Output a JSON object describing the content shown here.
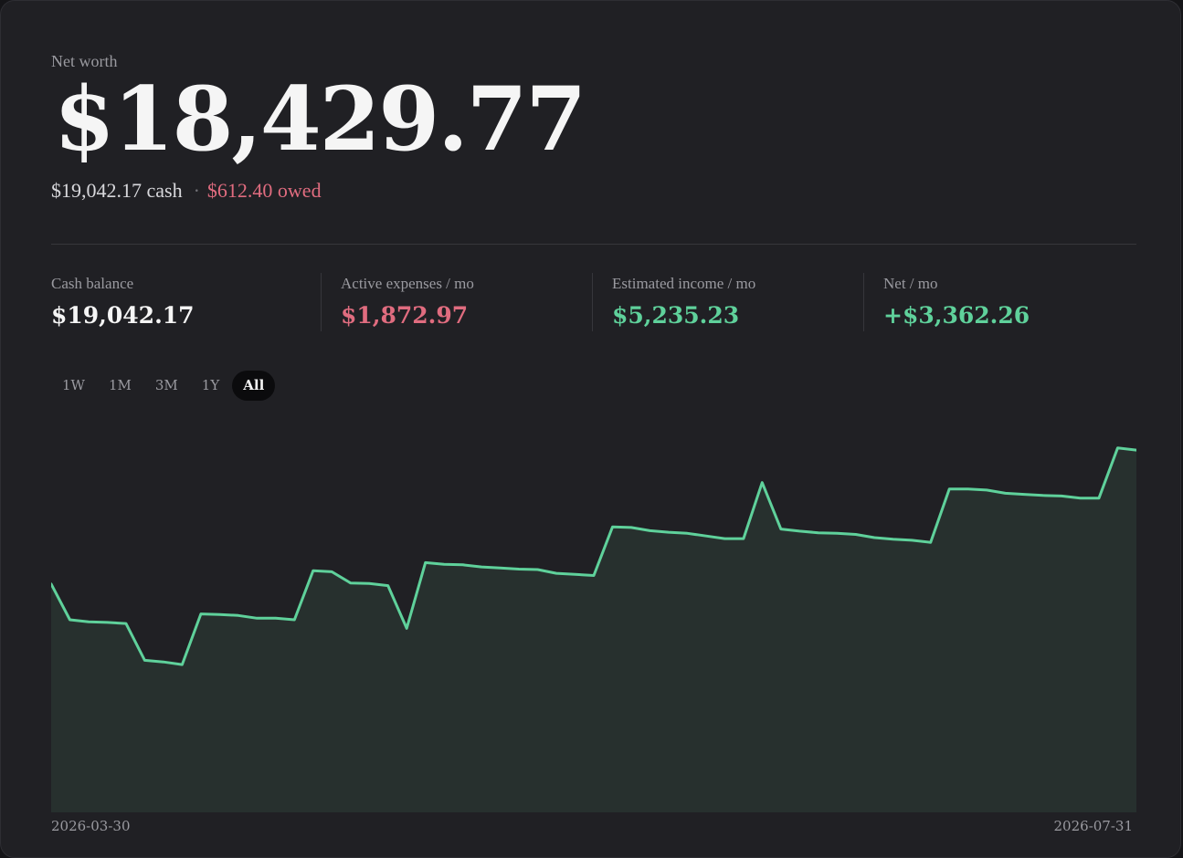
{
  "net_worth": {
    "label": "Net worth",
    "value": "$18,429.77",
    "cash_text": "$19,042.17 cash",
    "separator": "·",
    "owed_text": "$612.40 owed"
  },
  "stats": [
    {
      "label": "Cash balance",
      "value": "$19,042.17"
    },
    {
      "label": "Active expenses / mo",
      "value": "$1,872.97"
    },
    {
      "label": "Estimated income / mo",
      "value": "$5,235.23"
    },
    {
      "label": "Net / mo",
      "value": "+$3,362.26"
    }
  ],
  "range": {
    "options": [
      "1W",
      "1M",
      "3M",
      "1Y",
      "All"
    ],
    "selected": "All"
  },
  "chart_data": {
    "type": "area",
    "x_start_label": "2026-03-30",
    "x_end_label": "2026-07-31",
    "series": [
      {
        "values": [
          4210,
          3540,
          3500,
          3490,
          3470,
          2780,
          2750,
          2700,
          3650,
          3640,
          3620,
          3570,
          3570,
          3540,
          4460,
          4440,
          4230,
          4220,
          4180,
          3380,
          4610,
          4580,
          4570,
          4530,
          4510,
          4490,
          4480,
          4410,
          4390,
          4370,
          5280,
          5270,
          5210,
          5180,
          5160,
          5110,
          5060,
          5060,
          6110,
          5240,
          5200,
          5170,
          5160,
          5140,
          5080,
          5050,
          5030,
          4990,
          5990,
          5990,
          5970,
          5910,
          5890,
          5870,
          5860,
          5820,
          5820,
          6760,
          6720
        ]
      }
    ],
    "colors": {
      "line": "#5fd19b",
      "fill": "#27302e"
    }
  }
}
